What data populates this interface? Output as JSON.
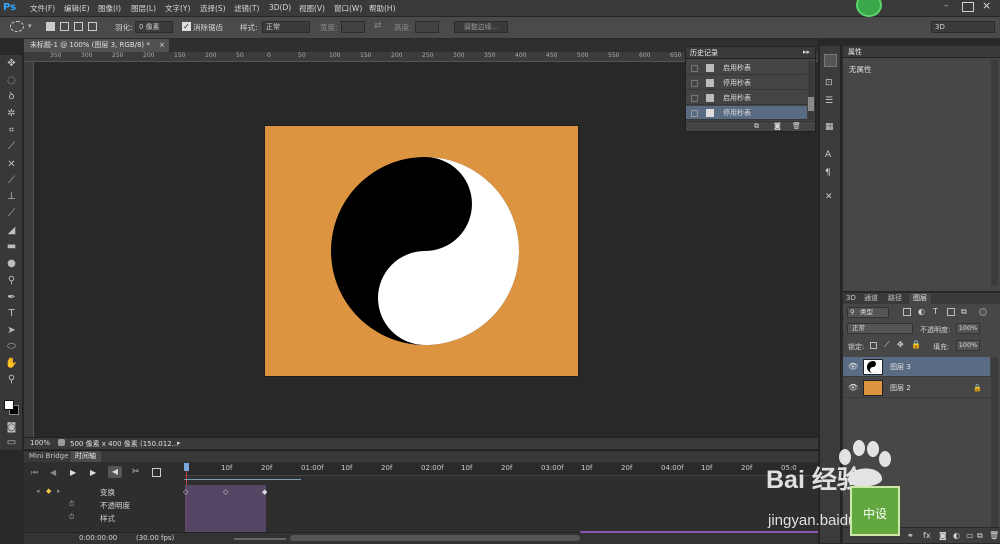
{
  "app": {
    "logo": "Ps"
  },
  "menu": {
    "items": [
      "文件(F)",
      "编辑(E)",
      "图像(I)",
      "图层(L)",
      "文字(Y)",
      "选择(S)",
      "滤镜(T)",
      "3D(D)",
      "视图(V)",
      "窗口(W)",
      "帮助(H)"
    ]
  },
  "options_bar": {
    "feather_label": "羽化:",
    "feather_value": "0 像素",
    "antialias_label": "消除锯齿",
    "style_label": "样式:",
    "style_value": "正常",
    "width_label": "宽度:",
    "height_label": "高度:",
    "refine_edge": "调整边缘...",
    "workspace": "3D"
  },
  "document": {
    "tab_title": "未标题-1 @ 100% (图层 3, RGB/8) *",
    "zoom": "100%",
    "doc_info": "500 像素 x 400 像素 (150.012...",
    "ruler_ticks": [
      "350",
      "300",
      "250",
      "200",
      "150",
      "100",
      "50",
      "0",
      "50",
      "100",
      "150",
      "200",
      "250",
      "300",
      "350",
      "400",
      "450",
      "500",
      "550",
      "600",
      "650"
    ],
    "artboard_color": "#dd9440"
  },
  "history": {
    "title": "历史记录",
    "items": [
      {
        "label": "启用秒表",
        "selected": false
      },
      {
        "label": "停用秒表",
        "selected": false
      },
      {
        "label": "启用秒表",
        "selected": false
      },
      {
        "label": "停用秒表",
        "selected": true
      }
    ]
  },
  "properties": {
    "title": "属性",
    "content": "无属性"
  },
  "layers_panel": {
    "tabs": [
      "3D",
      "通道",
      "路径",
      "图层"
    ],
    "active_tab": "图层",
    "filter_value": "类型",
    "blend_mode": "正常",
    "opacity_label": "不透明度:",
    "opacity_value": "100%",
    "lock_label": "锁定:",
    "fill_label": "填充:",
    "fill_value": "100%",
    "layers": [
      {
        "name": "图层 3",
        "selected": true
      },
      {
        "name": "图层 2",
        "selected": false
      }
    ]
  },
  "timeline": {
    "tabs": [
      "Mini Bridge",
      "时间轴"
    ],
    "active_tab": "时间轴",
    "ruler_labels": [
      "10f",
      "20f",
      "01:00f",
      "10f",
      "20f",
      "02:00f",
      "10f",
      "20f",
      "03:00f",
      "10f",
      "20f",
      "04:00f",
      "10f",
      "20f",
      "05:0"
    ],
    "tracks": [
      "变换",
      "不透明度",
      "样式"
    ],
    "timecode": "0:00:00:00",
    "fps": "(30.00 fps)"
  },
  "watermark": {
    "brand": "Bai 经验",
    "url": "jingyan.baidu.com",
    "badge": "中设"
  },
  "colors": {
    "accent_blue": "#31a8ff",
    "selection": "#5a6b84"
  }
}
